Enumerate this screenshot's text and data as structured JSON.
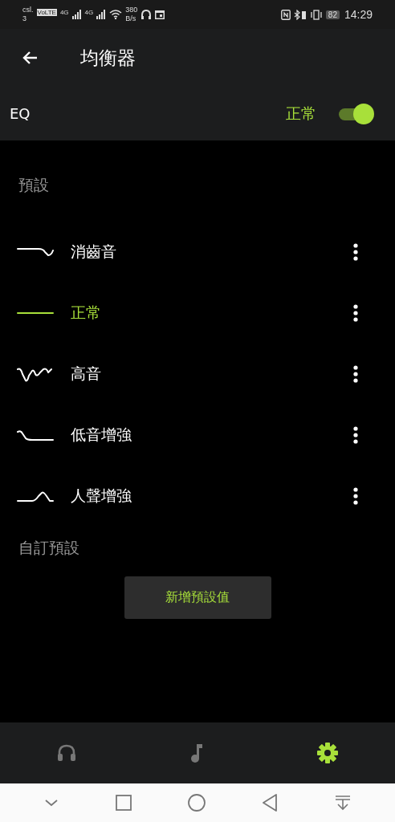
{
  "status_bar": {
    "carrier": "csl.",
    "carrier_line2": "3",
    "volte": "VoLTE",
    "signal_1": "4G",
    "signal_2": "4G",
    "speed": "380",
    "speed_unit": "B/s",
    "battery": "82",
    "time": "14:29"
  },
  "header": {
    "title": "均衡器"
  },
  "eq": {
    "label": "EQ",
    "status": "正常",
    "on": true
  },
  "presets_heading": "預設",
  "presets": [
    {
      "label": "消齒音",
      "selected": false
    },
    {
      "label": "正常",
      "selected": true
    },
    {
      "label": "高音",
      "selected": false
    },
    {
      "label": "低音增強",
      "selected": false
    },
    {
      "label": "人聲增強",
      "selected": false
    }
  ],
  "custom_heading": "自訂預設",
  "add_button": "新增預設值",
  "bottom_tabs": [
    {
      "kind": "headphones",
      "selected": false
    },
    {
      "kind": "music",
      "selected": false
    },
    {
      "kind": "settings",
      "selected": true
    }
  ]
}
